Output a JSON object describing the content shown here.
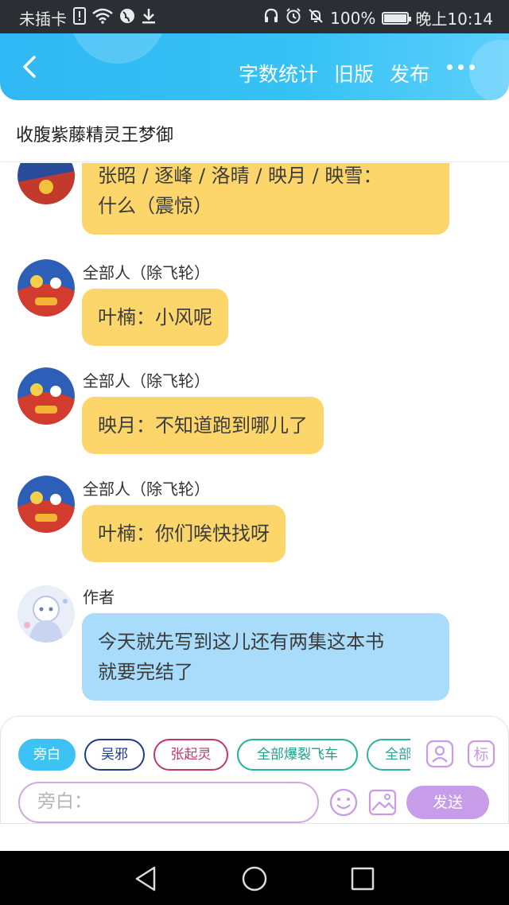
{
  "status_bar": {
    "carrier": "未插卡",
    "battery": "100%",
    "battery_level": 1.0,
    "time": "晚上10:14",
    "left_icons": [
      "sim-alert-icon",
      "wifi-icon",
      "globe-icon",
      "download-icon"
    ],
    "right_icons": [
      "headphones-icon",
      "alarm-icon",
      "mute-icon",
      "battery-icon"
    ]
  },
  "app_bar": {
    "back_icon": "chevron-left-icon",
    "word_count": "字数统计",
    "old_version": "旧版",
    "publish": "发布",
    "more_icon": "more-dots-icon"
  },
  "story_title": "收腹紫藤精灵王梦御",
  "messages": [
    {
      "speaker": "",
      "text_lines": [
        "张昭 / 逐峰 / 洛晴 / 映月 / 映雪：",
        "什么（震惊）"
      ],
      "bubble": "yellow"
    },
    {
      "speaker": "全部人（除飞轮）",
      "text_lines": [
        "叶楠：小风呢"
      ],
      "bubble": "yellow"
    },
    {
      "speaker": "全部人（除飞轮）",
      "text_lines": [
        "映月：不知道跑到哪儿了"
      ],
      "bubble": "yellow"
    },
    {
      "speaker": "全部人（除飞轮）",
      "text_lines": [
        "叶楠：你们唉快找呀"
      ],
      "bubble": "yellow"
    },
    {
      "speaker": "作者",
      "text_lines": [
        "今天就先写到这儿还有两集这本书",
        "就要完结了"
      ],
      "bubble": "blue"
    }
  ],
  "composer": {
    "roles": [
      "旁白",
      "吴邪",
      "张起灵",
      "全部爆裂飞车",
      "全部"
    ],
    "role_manage_icon": "role-card-icon",
    "tag_label": "标",
    "placeholder": "旁白：",
    "emoji_icon": "emoji-icon",
    "image_icon": "image-icon",
    "send_label": "发送"
  },
  "colors": {
    "header": "#37c2f5",
    "bubble_yellow": "#fdd66b",
    "bubble_blue": "#a9dcfb",
    "send": "#c79ce8"
  }
}
